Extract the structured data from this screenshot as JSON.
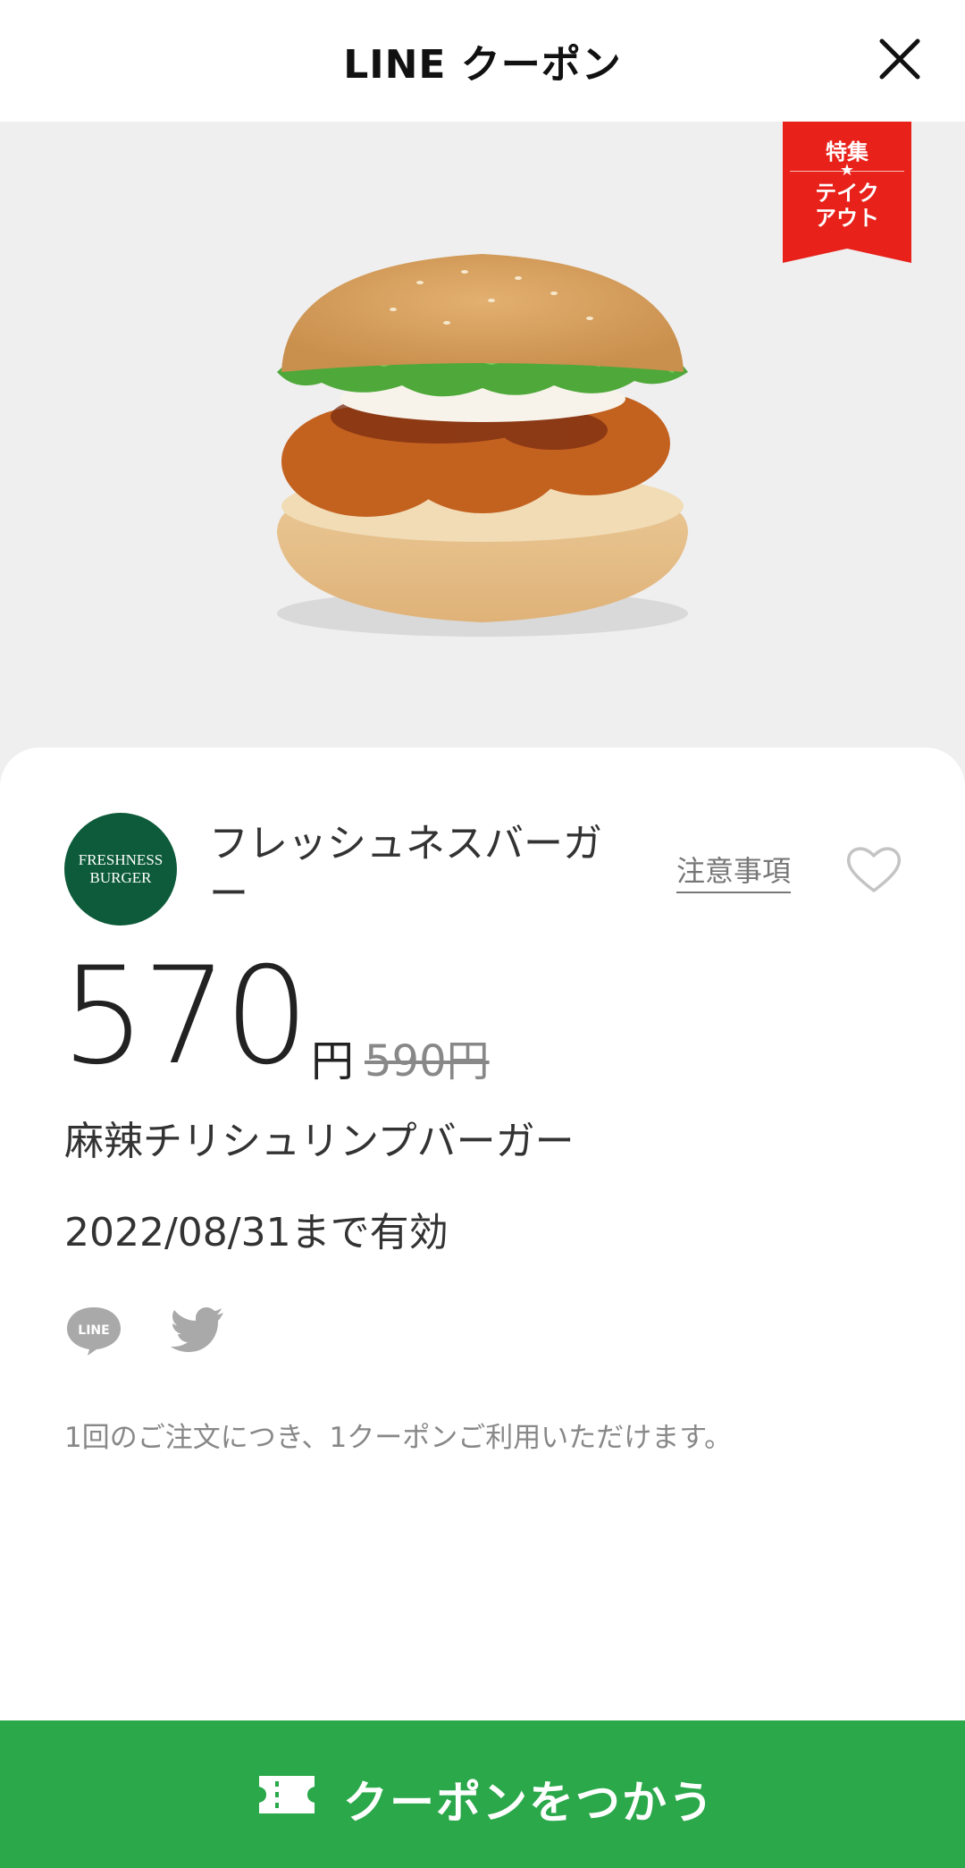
{
  "header": {
    "title": "LINE クーポン",
    "close_icon": "close-icon"
  },
  "ribbon": {
    "top": "特集",
    "star": "★",
    "bottom_line1": "テイク",
    "bottom_line2": "アウト",
    "color": "#e8211a"
  },
  "brand": {
    "logo_line1": "FRESHNESS",
    "logo_line2": "BURGER",
    "logo_color": "#0d5b3a",
    "name": "フレッシュネスバーガー"
  },
  "notes_label": "注意事項",
  "favorite_icon": "heart-outline-icon",
  "price": {
    "value": "570",
    "unit": "円",
    "original": "590円"
  },
  "product_name": "麻辣チリシュリンプバーガー",
  "validity": "2022/08/31まで有効",
  "share": {
    "line_label": "LINE",
    "line_icon": "line-share-icon",
    "twitter_icon": "twitter-icon"
  },
  "usage_note": "1回のご注文につき、1クーポンご利用いただけます。",
  "cta": {
    "label": "クーポンをつかう",
    "icon": "ticket-icon",
    "color": "#2aa84a"
  }
}
